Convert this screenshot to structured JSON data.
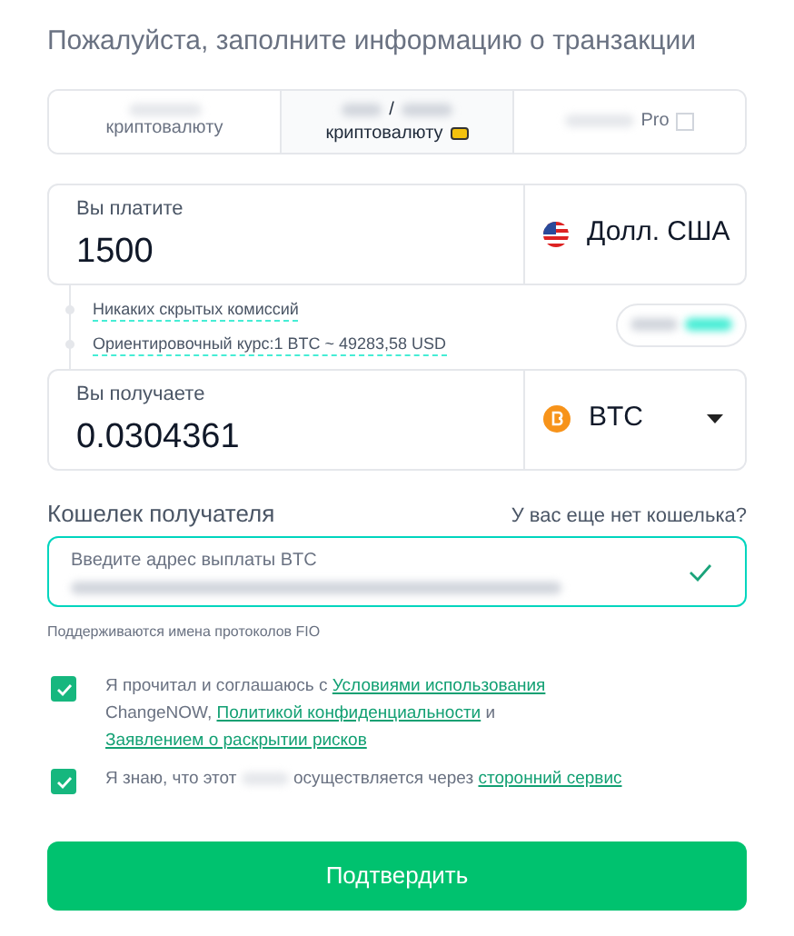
{
  "title": "Пожалуйста, заполните информацию о транзакции",
  "tabs": [
    {
      "lines": [
        "криптовалюту"
      ],
      "selected": false,
      "kind": "plain"
    },
    {
      "lines": [
        "/",
        "криптовалюту"
      ],
      "selected": true,
      "kind": "card"
    },
    {
      "lines": [
        "Pro"
      ],
      "selected": false,
      "kind": "pro"
    }
  ],
  "pay": {
    "label": "Вы платите",
    "value": "1500",
    "currency": "Долл. США",
    "kind": "fiat"
  },
  "info": [
    "Никаких скрытых комиссий",
    "Ориентировочный курс:1 BTC ~ 49283,58 USD"
  ],
  "receive": {
    "label": "Вы получаете",
    "value": "0.0304361",
    "currency": "BTC",
    "kind": "crypto"
  },
  "wallet": {
    "label": "Кошелек получателя",
    "link": "У вас еще нет кошелька?",
    "field_label": "Введите адрес выплаты BTC",
    "valid": true,
    "hint": "Поддерживаются имена протоколов FIO"
  },
  "agreements": [
    {
      "checked": true,
      "parts": [
        {
          "kind": "text",
          "text": "Я прочитал и соглашаюсь с "
        },
        {
          "kind": "link",
          "text": "Условиями использования"
        },
        {
          "kind": "text",
          "text": " ChangeNOW, "
        },
        {
          "kind": "link",
          "text": "Политикой конфиденциальности"
        },
        {
          "kind": "text",
          "text": " и "
        },
        {
          "kind": "link",
          "text": "Заявлением о раскрытии рисков"
        }
      ]
    },
    {
      "checked": true,
      "parts": [
        {
          "kind": "text",
          "text": "Я знаю, что этот "
        },
        {
          "kind": "blur"
        },
        {
          "kind": "text",
          "text": " осуществляется через "
        },
        {
          "kind": "link",
          "text": "сторонний сервис"
        }
      ]
    }
  ],
  "submit": "Подтвердить"
}
